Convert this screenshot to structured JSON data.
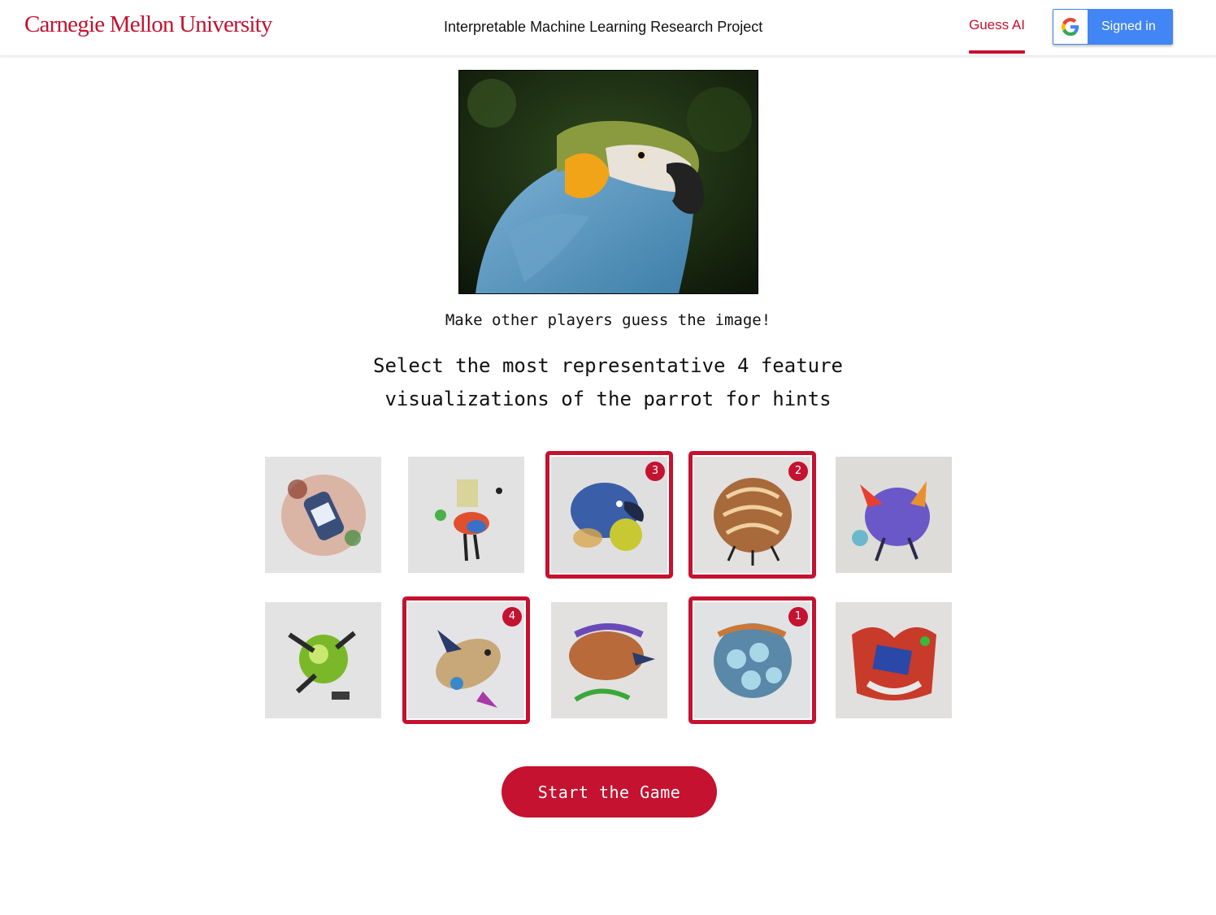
{
  "header": {
    "brand": "Carnegie Mellon University",
    "project_title": "Interpretable Machine Learning Research Project",
    "nav_link": "Guess AI",
    "signin_label": "Signed in",
    "accent_color": "#c41230",
    "google_blue": "#4285f4"
  },
  "hero": {
    "subject": "parrot"
  },
  "main": {
    "subtitle": "Make other players guess the image!",
    "instruction_line1": "Select the most representative 4 feature",
    "instruction_line2": "visualizations of the parrot for hints",
    "start_label": "Start the Game"
  },
  "tiles": [
    {
      "selected": false,
      "rank": ""
    },
    {
      "selected": false,
      "rank": ""
    },
    {
      "selected": true,
      "rank": "3"
    },
    {
      "selected": true,
      "rank": "2"
    },
    {
      "selected": false,
      "rank": ""
    },
    {
      "selected": false,
      "rank": ""
    },
    {
      "selected": true,
      "rank": "4"
    },
    {
      "selected": false,
      "rank": ""
    },
    {
      "selected": true,
      "rank": "1"
    },
    {
      "selected": false,
      "rank": ""
    }
  ]
}
